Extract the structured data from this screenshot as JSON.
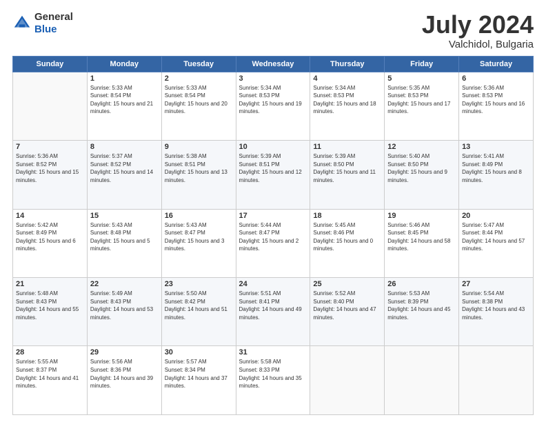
{
  "header": {
    "logo_general": "General",
    "logo_blue": "Blue",
    "title": "July 2024",
    "location": "Valchidol, Bulgaria"
  },
  "days_of_week": [
    "Sunday",
    "Monday",
    "Tuesday",
    "Wednesday",
    "Thursday",
    "Friday",
    "Saturday"
  ],
  "weeks": [
    [
      {
        "day": "",
        "sunrise": "",
        "sunset": "",
        "daylight": ""
      },
      {
        "day": "1",
        "sunrise": "Sunrise: 5:33 AM",
        "sunset": "Sunset: 8:54 PM",
        "daylight": "Daylight: 15 hours and 21 minutes."
      },
      {
        "day": "2",
        "sunrise": "Sunrise: 5:33 AM",
        "sunset": "Sunset: 8:54 PM",
        "daylight": "Daylight: 15 hours and 20 minutes."
      },
      {
        "day": "3",
        "sunrise": "Sunrise: 5:34 AM",
        "sunset": "Sunset: 8:53 PM",
        "daylight": "Daylight: 15 hours and 19 minutes."
      },
      {
        "day": "4",
        "sunrise": "Sunrise: 5:34 AM",
        "sunset": "Sunset: 8:53 PM",
        "daylight": "Daylight: 15 hours and 18 minutes."
      },
      {
        "day": "5",
        "sunrise": "Sunrise: 5:35 AM",
        "sunset": "Sunset: 8:53 PM",
        "daylight": "Daylight: 15 hours and 17 minutes."
      },
      {
        "day": "6",
        "sunrise": "Sunrise: 5:36 AM",
        "sunset": "Sunset: 8:53 PM",
        "daylight": "Daylight: 15 hours and 16 minutes."
      }
    ],
    [
      {
        "day": "7",
        "sunrise": "Sunrise: 5:36 AM",
        "sunset": "Sunset: 8:52 PM",
        "daylight": "Daylight: 15 hours and 15 minutes."
      },
      {
        "day": "8",
        "sunrise": "Sunrise: 5:37 AM",
        "sunset": "Sunset: 8:52 PM",
        "daylight": "Daylight: 15 hours and 14 minutes."
      },
      {
        "day": "9",
        "sunrise": "Sunrise: 5:38 AM",
        "sunset": "Sunset: 8:51 PM",
        "daylight": "Daylight: 15 hours and 13 minutes."
      },
      {
        "day": "10",
        "sunrise": "Sunrise: 5:39 AM",
        "sunset": "Sunset: 8:51 PM",
        "daylight": "Daylight: 15 hours and 12 minutes."
      },
      {
        "day": "11",
        "sunrise": "Sunrise: 5:39 AM",
        "sunset": "Sunset: 8:50 PM",
        "daylight": "Daylight: 15 hours and 11 minutes."
      },
      {
        "day": "12",
        "sunrise": "Sunrise: 5:40 AM",
        "sunset": "Sunset: 8:50 PM",
        "daylight": "Daylight: 15 hours and 9 minutes."
      },
      {
        "day": "13",
        "sunrise": "Sunrise: 5:41 AM",
        "sunset": "Sunset: 8:49 PM",
        "daylight": "Daylight: 15 hours and 8 minutes."
      }
    ],
    [
      {
        "day": "14",
        "sunrise": "Sunrise: 5:42 AM",
        "sunset": "Sunset: 8:49 PM",
        "daylight": "Daylight: 15 hours and 6 minutes."
      },
      {
        "day": "15",
        "sunrise": "Sunrise: 5:43 AM",
        "sunset": "Sunset: 8:48 PM",
        "daylight": "Daylight: 15 hours and 5 minutes."
      },
      {
        "day": "16",
        "sunrise": "Sunrise: 5:43 AM",
        "sunset": "Sunset: 8:47 PM",
        "daylight": "Daylight: 15 hours and 3 minutes."
      },
      {
        "day": "17",
        "sunrise": "Sunrise: 5:44 AM",
        "sunset": "Sunset: 8:47 PM",
        "daylight": "Daylight: 15 hours and 2 minutes."
      },
      {
        "day": "18",
        "sunrise": "Sunrise: 5:45 AM",
        "sunset": "Sunset: 8:46 PM",
        "daylight": "Daylight: 15 hours and 0 minutes."
      },
      {
        "day": "19",
        "sunrise": "Sunrise: 5:46 AM",
        "sunset": "Sunset: 8:45 PM",
        "daylight": "Daylight: 14 hours and 58 minutes."
      },
      {
        "day": "20",
        "sunrise": "Sunrise: 5:47 AM",
        "sunset": "Sunset: 8:44 PM",
        "daylight": "Daylight: 14 hours and 57 minutes."
      }
    ],
    [
      {
        "day": "21",
        "sunrise": "Sunrise: 5:48 AM",
        "sunset": "Sunset: 8:43 PM",
        "daylight": "Daylight: 14 hours and 55 minutes."
      },
      {
        "day": "22",
        "sunrise": "Sunrise: 5:49 AM",
        "sunset": "Sunset: 8:43 PM",
        "daylight": "Daylight: 14 hours and 53 minutes."
      },
      {
        "day": "23",
        "sunrise": "Sunrise: 5:50 AM",
        "sunset": "Sunset: 8:42 PM",
        "daylight": "Daylight: 14 hours and 51 minutes."
      },
      {
        "day": "24",
        "sunrise": "Sunrise: 5:51 AM",
        "sunset": "Sunset: 8:41 PM",
        "daylight": "Daylight: 14 hours and 49 minutes."
      },
      {
        "day": "25",
        "sunrise": "Sunrise: 5:52 AM",
        "sunset": "Sunset: 8:40 PM",
        "daylight": "Daylight: 14 hours and 47 minutes."
      },
      {
        "day": "26",
        "sunrise": "Sunrise: 5:53 AM",
        "sunset": "Sunset: 8:39 PM",
        "daylight": "Daylight: 14 hours and 45 minutes."
      },
      {
        "day": "27",
        "sunrise": "Sunrise: 5:54 AM",
        "sunset": "Sunset: 8:38 PM",
        "daylight": "Daylight: 14 hours and 43 minutes."
      }
    ],
    [
      {
        "day": "28",
        "sunrise": "Sunrise: 5:55 AM",
        "sunset": "Sunset: 8:37 PM",
        "daylight": "Daylight: 14 hours and 41 minutes."
      },
      {
        "day": "29",
        "sunrise": "Sunrise: 5:56 AM",
        "sunset": "Sunset: 8:36 PM",
        "daylight": "Daylight: 14 hours and 39 minutes."
      },
      {
        "day": "30",
        "sunrise": "Sunrise: 5:57 AM",
        "sunset": "Sunset: 8:34 PM",
        "daylight": "Daylight: 14 hours and 37 minutes."
      },
      {
        "day": "31",
        "sunrise": "Sunrise: 5:58 AM",
        "sunset": "Sunset: 8:33 PM",
        "daylight": "Daylight: 14 hours and 35 minutes."
      },
      {
        "day": "",
        "sunrise": "",
        "sunset": "",
        "daylight": ""
      },
      {
        "day": "",
        "sunrise": "",
        "sunset": "",
        "daylight": ""
      },
      {
        "day": "",
        "sunrise": "",
        "sunset": "",
        "daylight": ""
      }
    ]
  ]
}
